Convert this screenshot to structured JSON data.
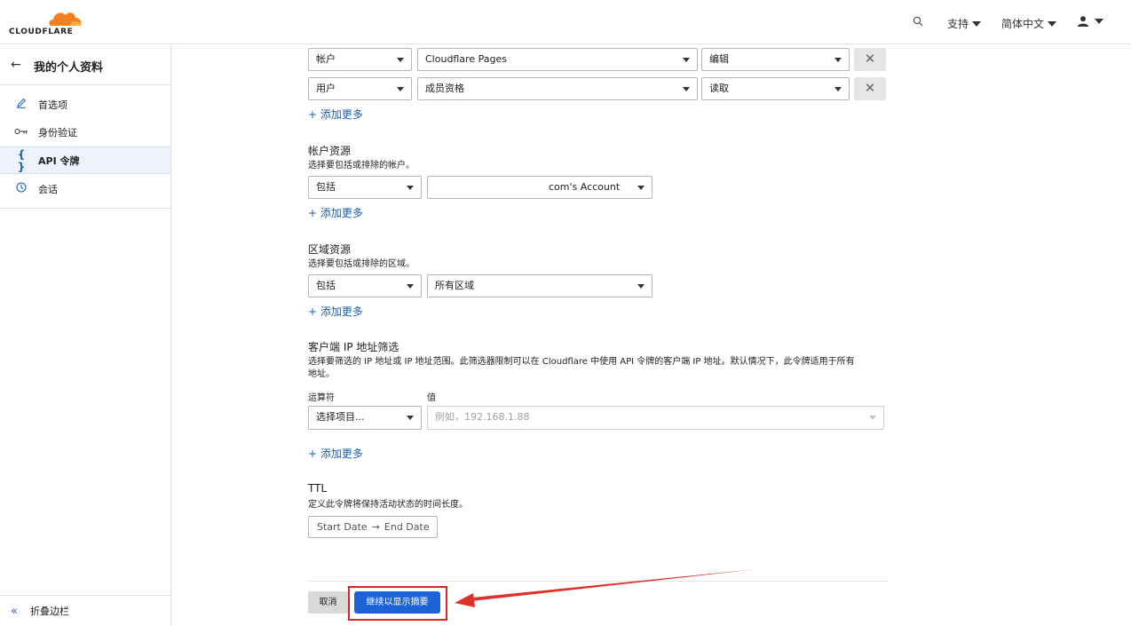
{
  "header": {
    "logo_text": "CLOUDFLARE",
    "support_label": "支持",
    "language_label": "简体中文",
    "brand_color": "#f38020"
  },
  "sidebar": {
    "back_title": "我的个人资料",
    "items": [
      {
        "label": "首选项",
        "icon": "pencil-icon"
      },
      {
        "label": "身份验证",
        "icon": "key-icon"
      },
      {
        "label": "API 令牌",
        "icon": "braces-icon",
        "active": true
      },
      {
        "label": "会话",
        "icon": "clock-icon"
      }
    ],
    "collapse_label": "折叠边栏"
  },
  "permissions": {
    "rows": [
      {
        "scope": "帐户",
        "item": "Cloudflare Pages",
        "access": "编辑"
      },
      {
        "scope": "用户",
        "item": "成员资格",
        "access": "读取"
      }
    ],
    "add_more": "+ 添加更多"
  },
  "account_resources": {
    "title": "帐户资源",
    "desc": "选择要包括或排除的帐户。",
    "include": "包括",
    "account": "com's Account",
    "add_more": "+ 添加更多"
  },
  "zone_resources": {
    "title": "区域资源",
    "desc": "选择要包括或排除的区域。",
    "include": "包括",
    "zone": "所有区域",
    "add_more": "+ 添加更多"
  },
  "ip_filter": {
    "title": "客户端 IP 地址筛选",
    "desc_line1": "选择要筛选的 IP 地址或 IP 地址范围。此筛选器限制可以在 Cloudflare 中使用 API 令牌的客户端 IP 地址。默认情况下，此令牌适用于所有",
    "desc_line2": "地址。",
    "operator_label": "运算符",
    "value_label": "值",
    "operator_placeholder": "选择项目...",
    "value_placeholder": "例如，192.168.1.88",
    "add_more": "+ 添加更多"
  },
  "ttl": {
    "title": "TTL",
    "desc": "定义此令牌将保持活动状态的时间长度。",
    "start": "Start Date",
    "arrow": "→",
    "end": "End Date"
  },
  "actions": {
    "cancel": "取消",
    "continue": "继续以显示摘要",
    "primary_color": "#1e63d6",
    "highlight_color": "#e02424"
  }
}
